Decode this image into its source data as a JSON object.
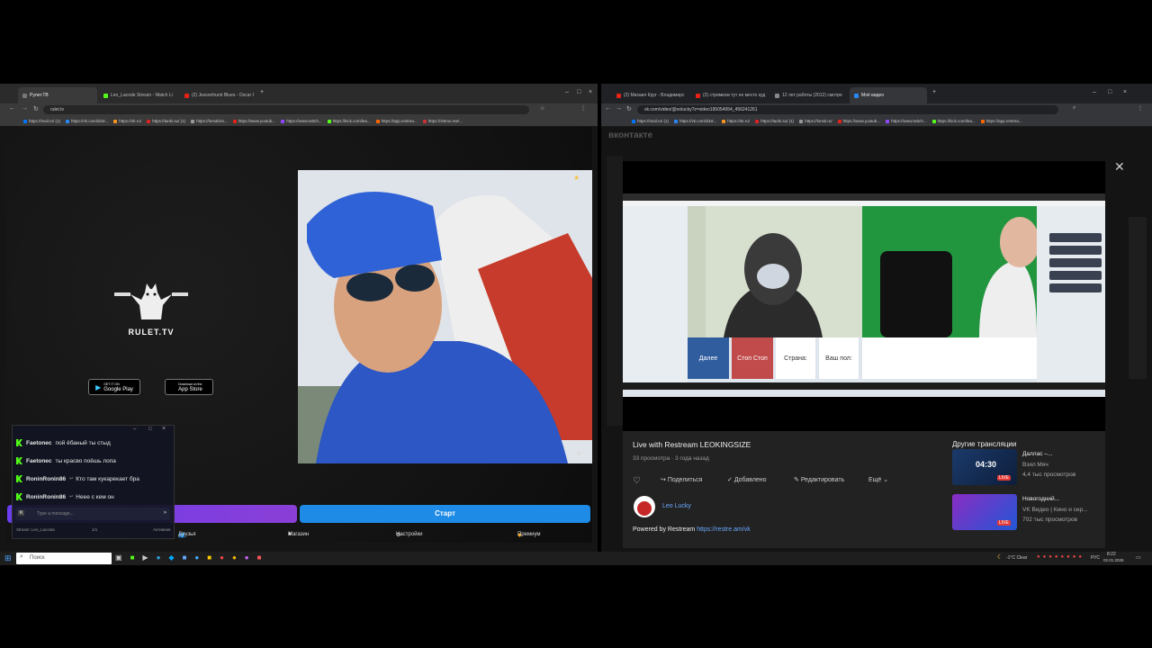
{
  "left": {
    "tabs": [
      {
        "label": "Рулет.ТВ",
        "color": "#2a2a2a"
      },
      {
        "label": "Leo_Lacode Stream - Watch Li",
        "color": "#53fc18"
      },
      {
        "label": "(2) Jessonhurst Blues - Oscar I",
        "color": "#e62117"
      }
    ],
    "url": "rulet.tv",
    "bookmarks": [
      "https://mail.ru/ (1)",
      "https://vk.com/id18...",
      "https://ok.ru/",
      "https://tanki.su/ (1)",
      "https://lonsticks...",
      "https://www.youtub...",
      "https://www.twitch...",
      "https://kick.com/lea...",
      "https://app.restrea...",
      "https://ztemo.me/..."
    ],
    "logo_text": "RULET.TV",
    "store1_top": "GET IT ON",
    "store1": "Google Play",
    "store2_top": "Download on the",
    "store2": "App Store",
    "start_label": "Старт",
    "nav": [
      "Друзья",
      "Магазин",
      "Настройки",
      "Премиум"
    ],
    "chat": {
      "messages": [
        {
          "user": "Faetonec",
          "text": "пой ёбаный ты стыд"
        },
        {
          "user": "Faetonec",
          "text": "ты красво поёшь лопа"
        },
        {
          "user": "RoninRonin86",
          "text": "Кто там кукарекает бра"
        },
        {
          "user": "RoninRonin86",
          "text": "Неее с кем он"
        }
      ],
      "input_placeholder": "Type a message...",
      "footer_stream": "Stream: Leo_Lacosta",
      "footer_count": "1/1",
      "footer_right": "Активная"
    }
  },
  "right": {
    "tabs": [
      {
        "label": "(2) Михаил Круг - Владимирс",
        "color": "#e62117"
      },
      {
        "label": "(2) стримком тут не место куд",
        "color": "#e62117"
      },
      {
        "label": "12 лет работы (2012) смотре",
        "color": "#888888"
      },
      {
        "label": "Моё видео",
        "color": "#2787f5"
      }
    ],
    "url": "vk.com/video/@oolucky?z=video195054954_456241261",
    "bookmarks": [
      "https://mail.ru/ (1)",
      "https://vk.com/id18...",
      "https://ok.ru/",
      "https://tanki.su/ (1)",
      "https://lonsti.ru/",
      "https://www.youtub...",
      "https://www.twitch...",
      "https://kick.com/lea...",
      "https://app.restrea..."
    ],
    "vk_logo": "вконтакте",
    "inner_buttons": [
      "Далее",
      "Стоп Стоп",
      "Страна:",
      "Ваш пол:"
    ],
    "video_title": "Live with Restream LEOKINGSIZE",
    "views": "33 просмотра",
    "ago": "3 года назад",
    "actions": [
      "Поделиться",
      "Добавлено",
      "Редактировать",
      "Ещё"
    ],
    "channel": "Leo Lucky",
    "powered_prefix": "Powered by Restream",
    "powered_link": "https://restre.am/vk",
    "side_title": "Другие трансляции",
    "side": [
      {
        "title": "Даллас –...",
        "sub1": "Взял Мяч",
        "sub2": "4,4 тыс просмотров",
        "time": "04:30",
        "live": "LIVE"
      },
      {
        "title": "Новогодний...",
        "sub1": "VK Видео | Кино и сер...",
        "sub2": "702 тыс просмотров",
        "time": "",
        "live": "LIVE"
      }
    ]
  },
  "taskbar": {
    "search": "Поиск",
    "weather": "-1°C  Clear",
    "lang": "РУС",
    "time": "8:22",
    "date": "02.01.2026"
  }
}
